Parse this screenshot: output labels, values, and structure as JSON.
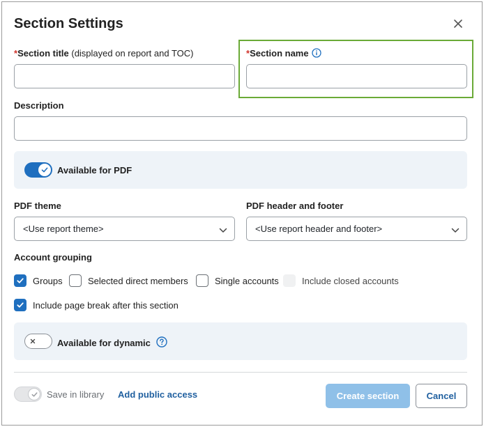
{
  "dialog": {
    "title": "Section Settings",
    "close_icon": "close-icon"
  },
  "fields": {
    "section_title": {
      "required_mark": "*",
      "label": "Section title",
      "note": " (displayed on report and TOC)",
      "value": ""
    },
    "section_name": {
      "required_mark": "*",
      "label": "Section name",
      "icon": "info-icon",
      "value": ""
    },
    "description": {
      "label": "Description",
      "value": ""
    }
  },
  "pdf_panel": {
    "toggle_label": "Available for PDF",
    "toggle_on": true
  },
  "pdf_theme": {
    "label": "PDF theme",
    "selected": "<Use report theme>"
  },
  "pdf_header_footer": {
    "label": "PDF header and footer",
    "selected": "<Use report header and footer>"
  },
  "account_grouping": {
    "label": "Account grouping",
    "options": [
      {
        "label": "Groups",
        "checked": true
      },
      {
        "label": "Selected direct members",
        "checked": false
      },
      {
        "label": "Single accounts",
        "checked": false
      },
      {
        "label": "Include closed accounts",
        "checked": false,
        "disabled": true
      }
    ]
  },
  "page_break": {
    "label": "Include page break after this section",
    "checked": true
  },
  "dynamic_panel": {
    "toggle_label": "Available for dynamic",
    "toggle_on": false,
    "icon": "help-icon"
  },
  "footer": {
    "save_in_library": "Save in library",
    "add_public_access": "Add public access",
    "create_section": "Create section",
    "cancel": "Cancel"
  },
  "colors": {
    "accent": "#1f6fbf",
    "highlight": "#6aaa37",
    "required": "#d0342c",
    "panel_bg": "#eef3f8",
    "primary_disabled": "#8fc0e8"
  }
}
